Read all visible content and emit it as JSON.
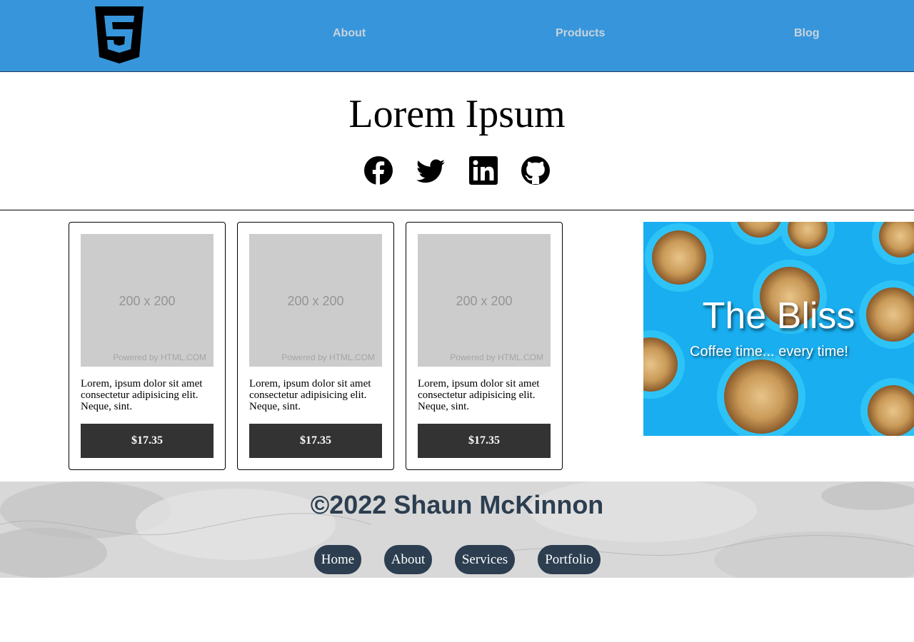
{
  "header": {
    "logo_icon": "html5-logo-icon",
    "nav": [
      {
        "label": "About"
      },
      {
        "label": "Products"
      },
      {
        "label": "Blog"
      }
    ]
  },
  "hero": {
    "title": "Lorem Ipsum",
    "social_icons": [
      "facebook-icon",
      "twitter-icon",
      "linkedin-icon",
      "github-icon"
    ]
  },
  "products": [
    {
      "image_text": "200 x 200",
      "image_credit": "Powered by HTML.COM",
      "description": "Lorem, ipsum dolor sit amet consectetur adipisicing elit. Neque, sint.",
      "price": "$17.35"
    },
    {
      "image_text": "200 x 200",
      "image_credit": "Powered by HTML.COM",
      "description": "Lorem, ipsum dolor sit amet consectetur adipisicing elit. Neque, sint.",
      "price": "$17.35"
    },
    {
      "image_text": "200 x 200",
      "image_credit": "Powered by HTML.COM",
      "description": "Lorem, ipsum dolor sit amet consectetur adipisicing elit. Neque, sint.",
      "price": "$17.35"
    }
  ],
  "promo": {
    "title": "The Bliss",
    "subtitle": "Coffee time... every time!"
  },
  "footer": {
    "copyright": "©2022 Shaun McKinnon",
    "links": [
      {
        "label": "Home"
      },
      {
        "label": "About"
      },
      {
        "label": "Services"
      },
      {
        "label": "Portfolio"
      }
    ]
  },
  "colors": {
    "header_bg": "#3796db",
    "nav_text": "#c8d3dc",
    "button_bg": "#333333",
    "footer_pill": "#2c3e50",
    "promo_bg": "#1ab0f0"
  }
}
